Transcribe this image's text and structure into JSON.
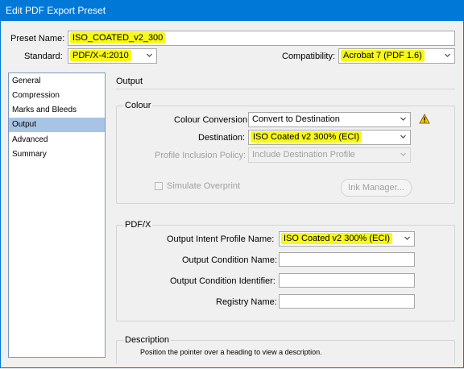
{
  "window": {
    "title": "Edit PDF Export Preset"
  },
  "preset": {
    "label": "Preset Name:",
    "value": "ISO_COATED_v2_300"
  },
  "standard": {
    "label": "Standard:",
    "value": "PDF/X-4:2010"
  },
  "compatibility": {
    "label": "Compatibility:",
    "value": "Acrobat 7 (PDF 1.6)"
  },
  "sidebar": {
    "items": [
      {
        "label": "General"
      },
      {
        "label": "Compression"
      },
      {
        "label": "Marks and Bleeds"
      },
      {
        "label": "Output",
        "selected": true
      },
      {
        "label": "Advanced"
      },
      {
        "label": "Summary"
      }
    ]
  },
  "main": {
    "heading": "Output"
  },
  "colour": {
    "title": "Colour",
    "conversion_label": "Colour Conversion:",
    "conversion_value": "Convert to Destination",
    "destination_label": "Destination:",
    "destination_value": "ISO Coated v2 300% (ECI)",
    "inclusion_label": "Profile Inclusion Policy:",
    "inclusion_value": "Include Destination Profile",
    "simulate_label": "Simulate Overprint",
    "ink_manager_label": "Ink Manager..."
  },
  "pdfx": {
    "title": "PDF/X",
    "intent_label": "Output Intent Profile Name:",
    "intent_value": "ISO Coated v2 300% (ECI)",
    "condition_name_label": "Output Condition Name:",
    "condition_id_label": "Output Condition Identifier:",
    "registry_label": "Registry Name:"
  },
  "description": {
    "title": "Description",
    "text": "Position the pointer over a heading to view a description."
  },
  "colors": {
    "title_bar": "#0078d7",
    "highlight": "#f8f816",
    "selection": "#a8c4e4"
  },
  "icons": {
    "warning": "warning-triangle-icon",
    "dropdown": "chevron-down-icon"
  }
}
